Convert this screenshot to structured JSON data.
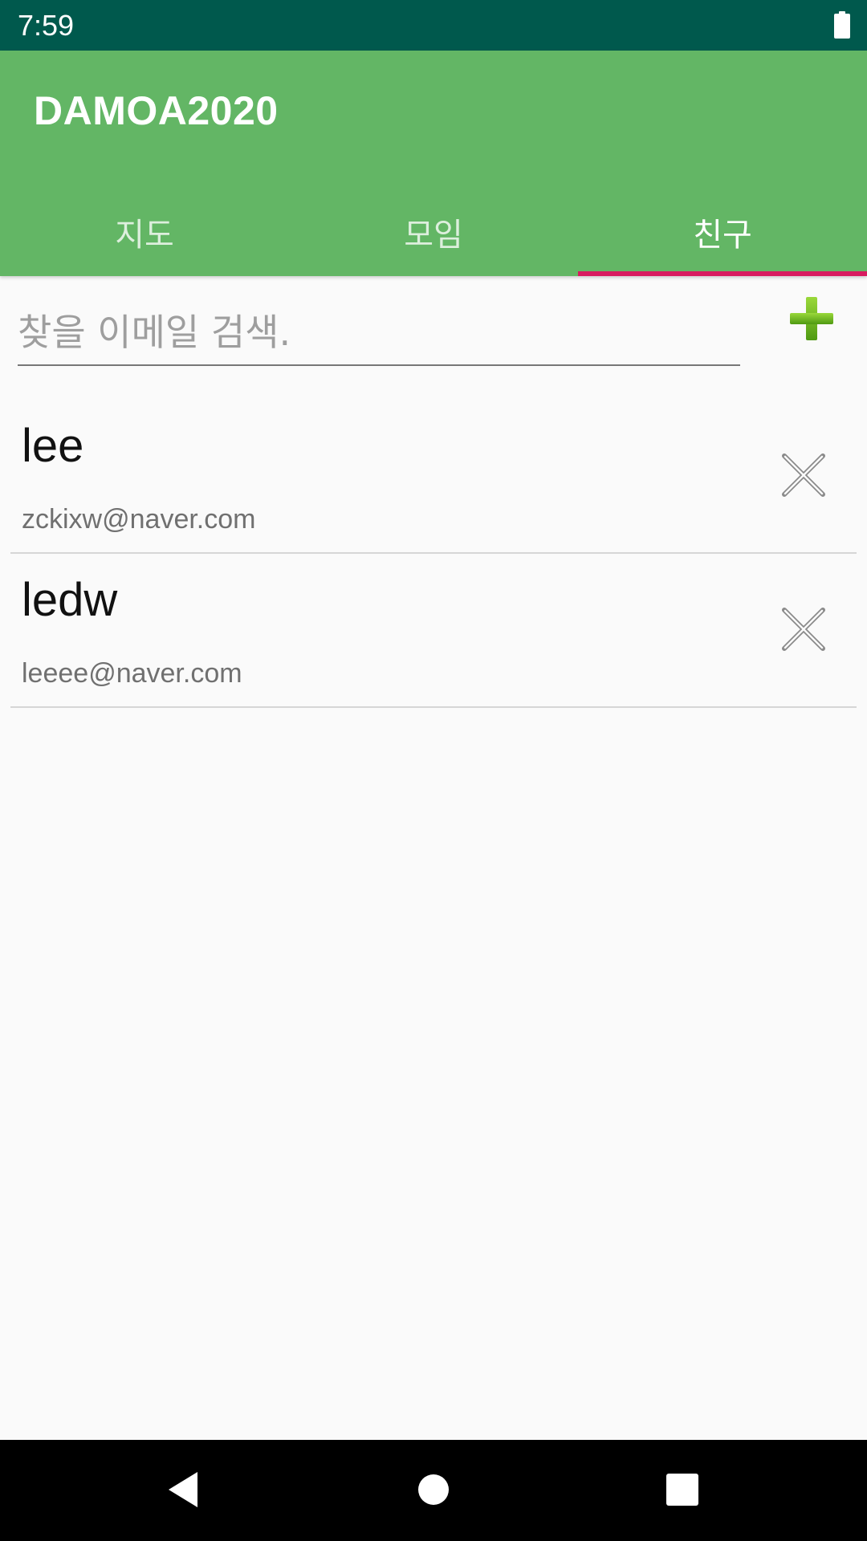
{
  "status_bar": {
    "time": "7:59",
    "icons": [
      "battery-icon"
    ],
    "color": "#00594d"
  },
  "app_bar": {
    "title": "DAMOA2020",
    "color": "#63b665",
    "tabs": [
      {
        "label": "지도",
        "active": false
      },
      {
        "label": "모임",
        "active": false
      },
      {
        "label": "친구",
        "active": true
      }
    ],
    "indicator_color": "#d81b60"
  },
  "search": {
    "placeholder": "찾을 이메일 검색.",
    "value": "",
    "add_icon": "plus-icon",
    "add_icon_color": "#6ab023"
  },
  "friends": [
    {
      "name": "lee",
      "email": "zckixw@naver.com",
      "action_icon": "close-icon"
    },
    {
      "name": "ledw",
      "email": "leeee@naver.com",
      "action_icon": "close-icon"
    }
  ],
  "nav_bar": {
    "buttons": [
      "back-icon",
      "home-icon",
      "recents-icon"
    ]
  }
}
